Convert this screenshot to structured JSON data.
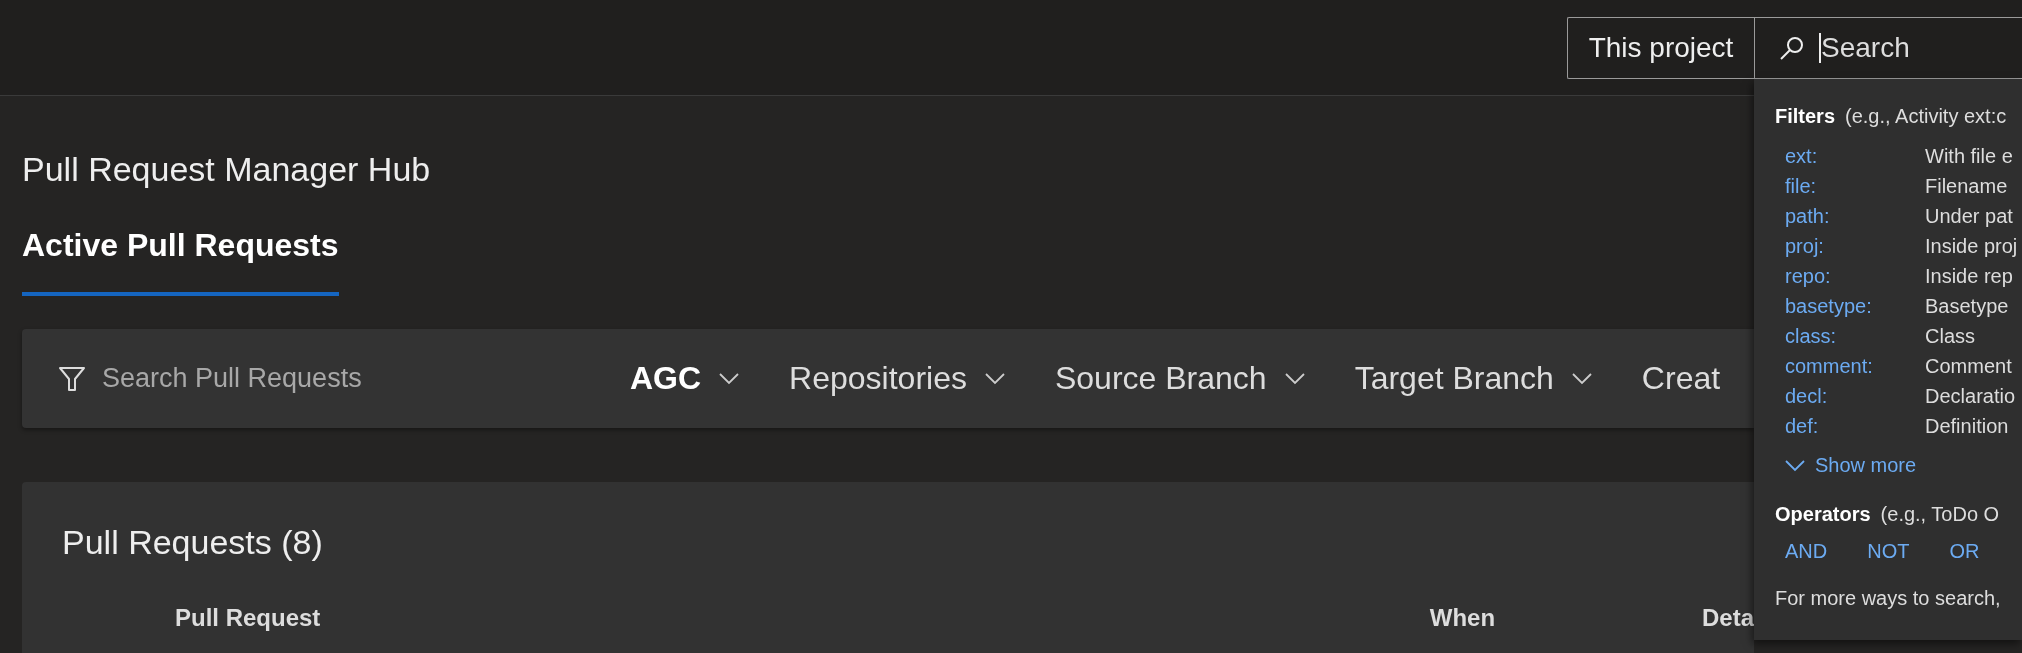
{
  "header": {
    "scope_button": "This project",
    "search": {
      "placeholder": "Search",
      "focused": true
    }
  },
  "page": {
    "title": "Pull Request Manager Hub",
    "tabs": [
      {
        "label": "Active Pull Requests",
        "selected": true
      }
    ]
  },
  "filter_bar": {
    "search_placeholder": "Search Pull Requests",
    "dropdowns": [
      {
        "label": "AGC",
        "applied": true,
        "chevron": true
      },
      {
        "label": "Repositories",
        "applied": false,
        "chevron": true
      },
      {
        "label": "Source Branch",
        "applied": false,
        "chevron": true
      },
      {
        "label": "Target Branch",
        "applied": false,
        "chevron": true
      },
      {
        "label": "Creat",
        "applied": false,
        "chevron": false
      }
    ]
  },
  "pull_requests": {
    "title": "Pull Requests (8)",
    "columns": [
      "Pull Request",
      "When",
      "Deta"
    ]
  },
  "search_help": {
    "filters": {
      "heading": "Filters",
      "example": "(e.g., Activity ext:c",
      "items": [
        {
          "key": "ext:",
          "description": "With file e"
        },
        {
          "key": "file:",
          "description": "Filename"
        },
        {
          "key": "path:",
          "description": "Under pat"
        },
        {
          "key": "proj:",
          "description": "Inside proj"
        },
        {
          "key": "repo:",
          "description": "Inside rep"
        },
        {
          "key": "basetype:",
          "description": "Basetype"
        },
        {
          "key": "class:",
          "description": "Class"
        },
        {
          "key": "comment:",
          "description": "Comment"
        },
        {
          "key": "decl:",
          "description": "Declaratio"
        },
        {
          "key": "def:",
          "description": "Definition"
        }
      ],
      "show_more": "Show more"
    },
    "operators": {
      "heading": "Operators",
      "example": "(e.g., ToDo O",
      "items": [
        "AND",
        "NOT",
        "OR"
      ]
    },
    "footer": "For more ways to search,"
  }
}
